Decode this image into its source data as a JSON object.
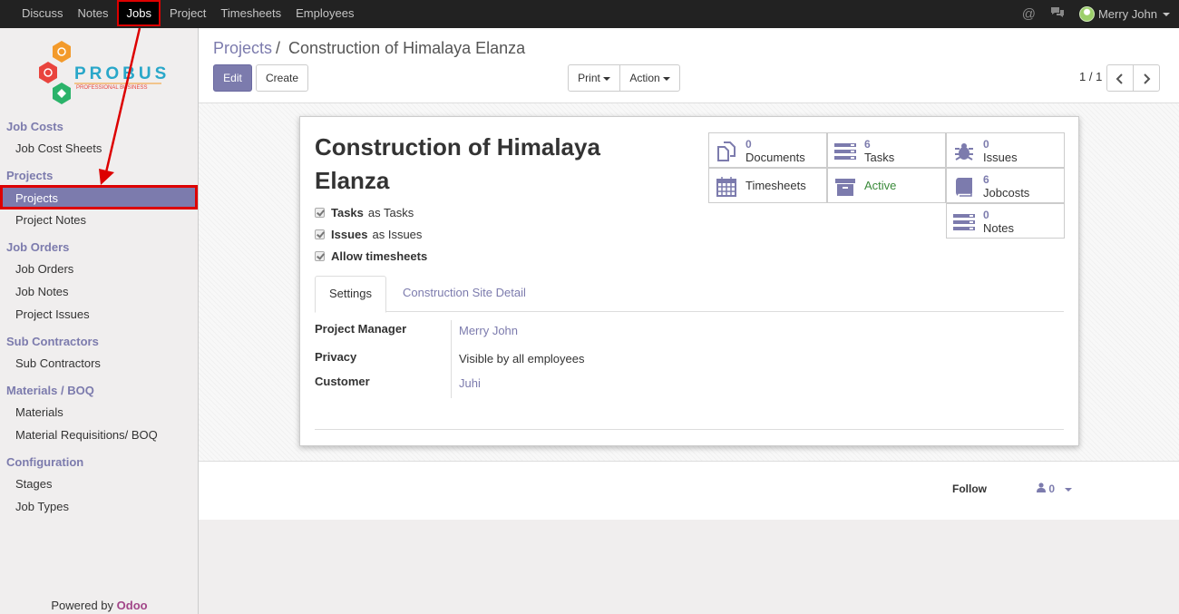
{
  "topbar": {
    "menu": [
      "Discuss",
      "Notes",
      "Jobs",
      "Project",
      "Timesheets",
      "Employees"
    ],
    "active_index": 2,
    "user_name": "Merry John"
  },
  "sidebar": {
    "logo_text": "PROBUSE",
    "logo_tagline": "PROFESSIONAL BUSINESS",
    "sections": {
      "job_costs": "Job Costs",
      "projects": "Projects",
      "job_orders": "Job Orders",
      "sub_contractors": "Sub Contractors",
      "materials": "Materials / BOQ",
      "configuration": "Configuration"
    },
    "items": {
      "job_cost_sheets": "Job Cost Sheets",
      "projects": "Projects",
      "project_notes": "Project Notes",
      "job_orders": "Job Orders",
      "job_notes": "Job Notes",
      "project_issues": "Project Issues",
      "sub_contractors": "Sub Contractors",
      "materials": "Materials",
      "material_requisitions": "Material Requisitions/ BOQ",
      "stages": "Stages",
      "job_types": "Job Types"
    },
    "powered_prefix": "Powered by ",
    "powered_brand": "Odoo"
  },
  "breadcrumb": {
    "parent": "Projects",
    "separator": "/",
    "current": "Construction of Himalaya Elanza"
  },
  "toolbar": {
    "edit": "Edit",
    "create": "Create",
    "print": "Print",
    "action": "Action",
    "pager": "1 / 1"
  },
  "form": {
    "title": "Construction of Himalaya Elanza",
    "checkboxes": [
      {
        "bold": "Tasks",
        "text": "as Tasks"
      },
      {
        "bold": "Issues",
        "text": "as Issues"
      },
      {
        "bold": "Allow timesheets",
        "text": ""
      }
    ],
    "smart_buttons": {
      "documents": {
        "count": "0",
        "label": "Documents"
      },
      "tasks": {
        "count": "6",
        "label": "Tasks"
      },
      "issues": {
        "count": "0",
        "label": "Issues"
      },
      "timesheets": {
        "label": "Timesheets"
      },
      "active": {
        "label": "Active"
      },
      "jobcosts": {
        "count": "6",
        "label": "Jobcosts"
      },
      "notes": {
        "count": "0",
        "label": "Notes"
      }
    },
    "tabs": [
      "Settings",
      "Construction Site Detail"
    ],
    "fields": {
      "project_manager_label": "Project Manager",
      "project_manager": "Merry John",
      "privacy_label": "Privacy",
      "privacy": "Visible by all employees",
      "customer_label": "Customer",
      "customer": "Juhi"
    }
  },
  "chatter": {
    "follow": "Follow",
    "followers_count": "0"
  },
  "colors": {
    "accent": "#7c7bad",
    "annotation": "#dd0000",
    "active_status": "#3a8a3a"
  }
}
